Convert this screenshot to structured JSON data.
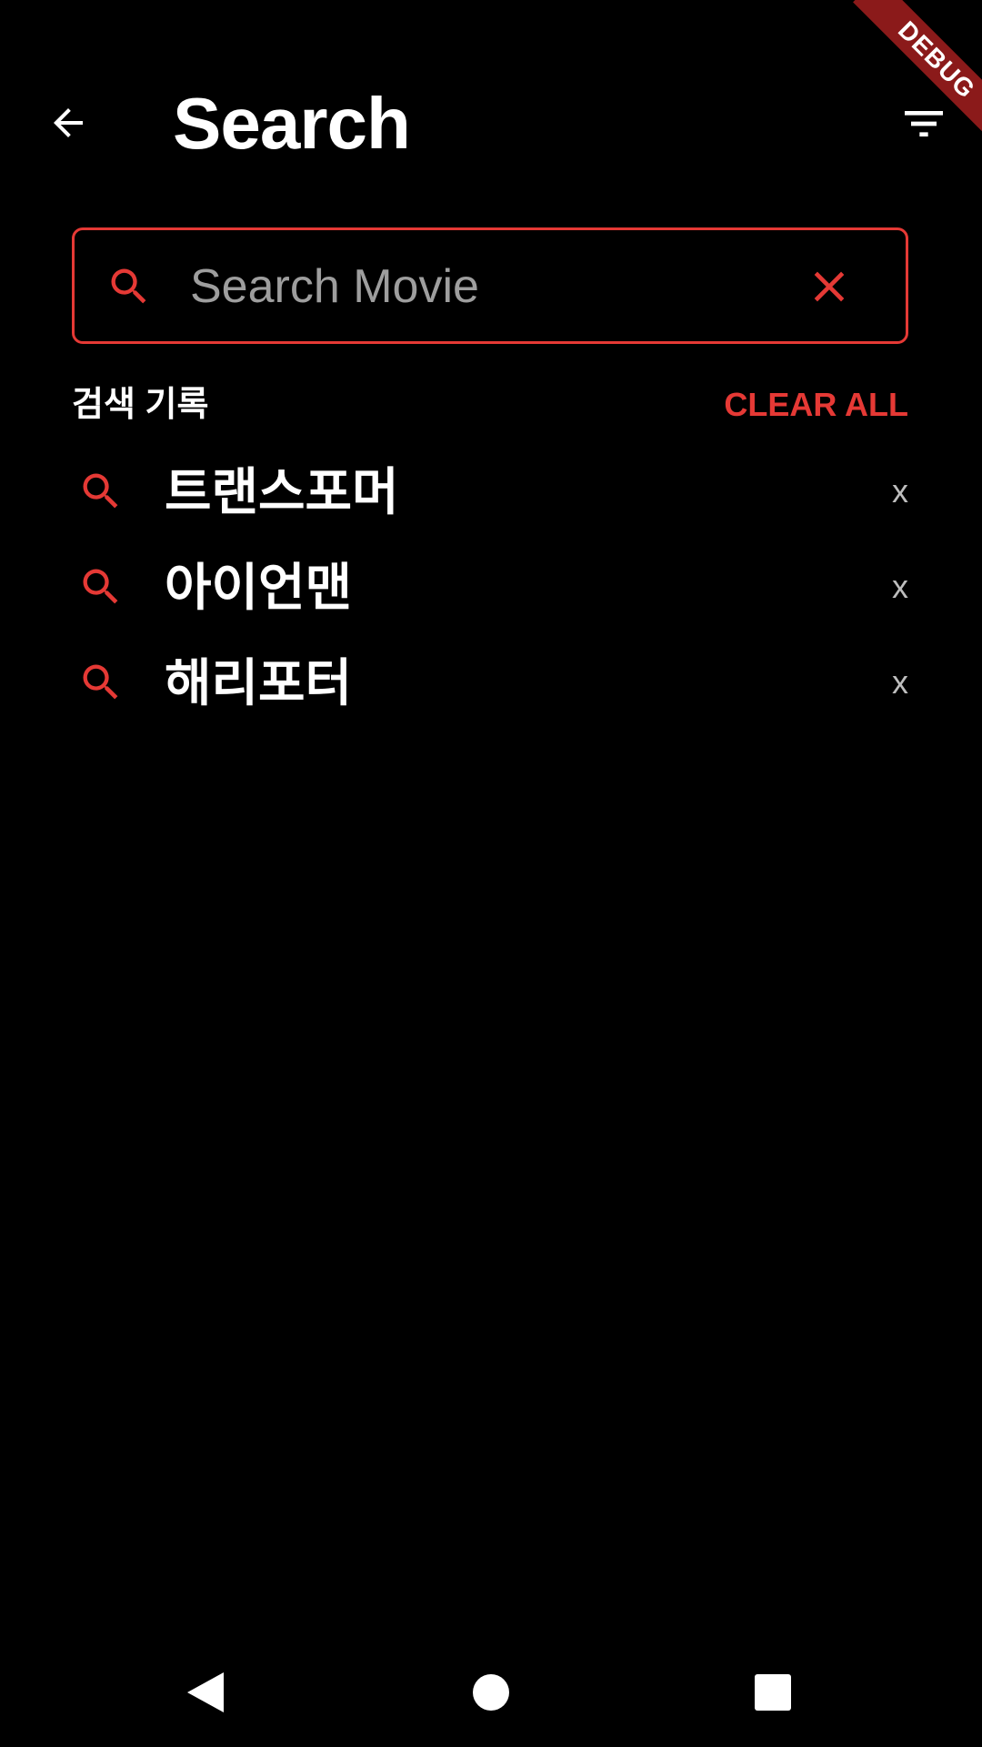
{
  "app_bar": {
    "title": "Search",
    "debug_banner": "DEBUG"
  },
  "search": {
    "placeholder": "Search Movie",
    "value": ""
  },
  "history": {
    "title": "검색 기록",
    "clear_all_label": "CLEAR ALL",
    "items": [
      {
        "label": "트랜스포머",
        "remove_label": "x"
      },
      {
        "label": "아이언맨",
        "remove_label": "x"
      },
      {
        "label": "해리포터",
        "remove_label": "x"
      }
    ]
  },
  "icons": {
    "back": "arrow-back-icon",
    "filter": "filter-icon",
    "search": "search-icon",
    "clear": "close-icon",
    "nav_back": "triangle-back-icon",
    "nav_home": "circle-home-icon",
    "nav_recents": "square-recents-icon"
  },
  "colors": {
    "background": "#000000",
    "accent": "#e53935",
    "text_primary": "#ffffff",
    "text_secondary": "#9e9e9e",
    "debug_banner": "#8b1a1a"
  }
}
